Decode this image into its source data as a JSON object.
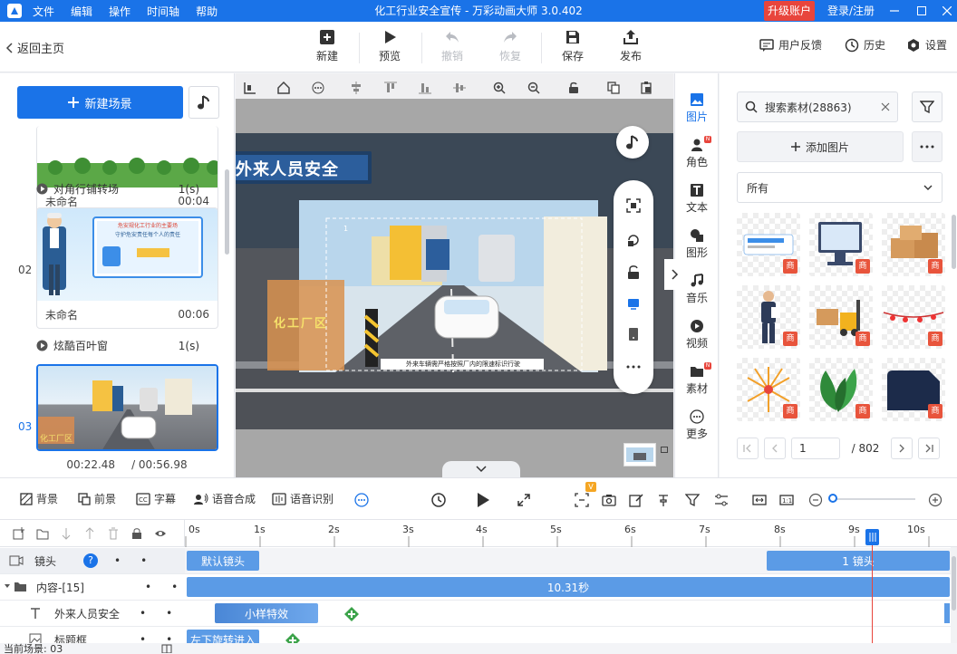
{
  "app": {
    "title": "化工行业安全宣传 - 万彩动画大师 3.0.402",
    "menu": [
      "文件",
      "编辑",
      "操作",
      "时间轴",
      "帮助"
    ],
    "upgrade": "升级账户",
    "login": "登录/注册"
  },
  "toolbar": {
    "back": "返回主页",
    "new": "新建",
    "preview": "预览",
    "undo": "撤销",
    "redo": "恢复",
    "save": "保存",
    "publish": "发布",
    "feedback": "用户反馈",
    "history": "历史",
    "settings": "设置"
  },
  "left": {
    "new_scene": "新建场景",
    "scenes": [
      {
        "number": "",
        "name": "未命名",
        "duration": "00:04"
      },
      {
        "number": "02",
        "name": "未命名",
        "duration": "00:06",
        "board_title": "危安规化工行业的主要场",
        "board_sub": "守护危安责任每个人的责任"
      },
      {
        "number": "03",
        "name": "",
        "duration": ""
      }
    ],
    "transitions": [
      {
        "name": "对角行铺转场",
        "dur": "1(s)"
      },
      {
        "name": "炫酷百叶窗",
        "dur": "1(s)"
      }
    ],
    "current_time": "00:22.48",
    "total_time": "/ 00:56.98"
  },
  "stage": {
    "sign": "外来人员安全",
    "factory_text": "化工厂区",
    "caption": "外来车辆需严格按照厂内的限速标识行驶",
    "layer_num": "1"
  },
  "categories": [
    {
      "label": "图片",
      "icon": "image-icon",
      "badge": false
    },
    {
      "label": "角色",
      "icon": "person-icon",
      "badge": true
    },
    {
      "label": "文本",
      "icon": "text-icon",
      "badge": false
    },
    {
      "label": "图形",
      "icon": "shape-icon",
      "badge": false
    },
    {
      "label": "音乐",
      "icon": "music-icon",
      "badge": false
    },
    {
      "label": "视频",
      "icon": "video-icon",
      "badge": false
    },
    {
      "label": "素材",
      "icon": "folder-icon",
      "badge": true
    },
    {
      "label": "更多",
      "icon": "more-icon",
      "badge": false
    }
  ],
  "materials": {
    "search_placeholder": "搜索素材(28863)",
    "add_image": "添加图片",
    "filter_value": "所有",
    "badge": "商",
    "page": "1",
    "total_pages": "/ 802"
  },
  "bottom": {
    "background": "背景",
    "foreground": "前景",
    "subtitle": "字幕",
    "tts": "语音合成",
    "asr": "语音识别",
    "vip_badge": "V"
  },
  "timeline": {
    "ticks": [
      "0s",
      "1s",
      "2s",
      "3s",
      "4s",
      "5s",
      "6s",
      "7s",
      "8s",
      "9s",
      "10s"
    ],
    "rows": [
      {
        "name": "镜头",
        "help": "?"
      },
      {
        "name": "内容-[15]"
      },
      {
        "name": "外来人员安全"
      },
      {
        "name": "标题框"
      }
    ],
    "blocks": {
      "default_cam": "默认镜头",
      "cam1": "1 镜头",
      "content": "10.31秒",
      "effect": "小样特效",
      "rotate_in": "左下旋转进入"
    }
  },
  "status": {
    "current_scene": "当前场景: 03"
  },
  "colors": {
    "accent": "#1a73e8",
    "danger": "#e8453c",
    "block": "#5b9be6"
  }
}
